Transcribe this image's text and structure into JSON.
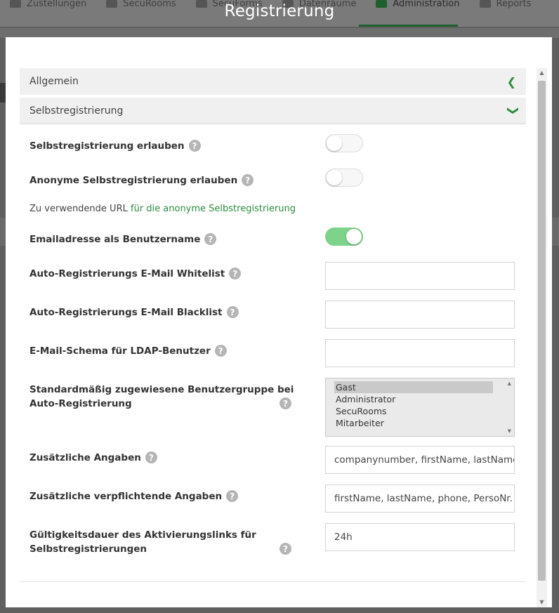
{
  "background_nav": {
    "items": [
      {
        "label": "Zustellungen",
        "icon": "envelope-icon"
      },
      {
        "label": "SecuRooms",
        "icon": "briefcase-icon"
      },
      {
        "label": "SecuForms",
        "icon": "form-icon"
      },
      {
        "label": "Datenräume",
        "icon": "datarooms-icon"
      },
      {
        "label": "Administration",
        "icon": "admin-icon",
        "active": true
      },
      {
        "label": "Reports",
        "icon": "list-icon"
      }
    ]
  },
  "modal": {
    "title": "Registrierung"
  },
  "accordion": {
    "general_label": "Allgemein",
    "self_reg_label": "Selbstregistrierung"
  },
  "form": {
    "allow_self_reg": {
      "label": "Selbstregistrierung erlauben",
      "enabled": false
    },
    "allow_anon_self_reg": {
      "label": "Anonyme Selbstregistrierung erlauben",
      "enabled": false
    },
    "url_hint": {
      "prefix": "Zu verwendende URL",
      "link": "für die anonyme Selbstregistrierung"
    },
    "email_as_username": {
      "label": "Emailadresse als Benutzername",
      "enabled": true
    },
    "whitelist": {
      "label": "Auto-Registrierungs E-Mail Whitelist",
      "value": ""
    },
    "blacklist": {
      "label": "Auto-Registrierungs E-Mail Blacklist",
      "value": ""
    },
    "ldap_schema": {
      "label": "E-Mail-Schema für LDAP-Benutzer",
      "value": ""
    },
    "default_group": {
      "label_line1": "Standardmäßig zugewiesene Benutzergruppe bei",
      "label_line2": "Auto-Registrierung",
      "options": [
        "Gast",
        "Administrator",
        "SecuRooms",
        "Mitarbeiter"
      ],
      "selected": "Gast"
    },
    "additional": {
      "label": "Zusätzliche Angaben",
      "value": "companynumber, firstName, lastName,"
    },
    "additional_required": {
      "label": "Zusätzliche verpflichtende Angaben",
      "value": "firstName, lastName, phone, PersoNr."
    },
    "link_validity": {
      "label_line1": "Gültigkeitsdauer des Aktivierungslinks für",
      "label_line2": "Selbstregistrierungen",
      "value": "24h"
    }
  },
  "help_glyph": "?",
  "colors": {
    "accent": "#2e8b40",
    "toggle_on": "#7ed38a"
  }
}
